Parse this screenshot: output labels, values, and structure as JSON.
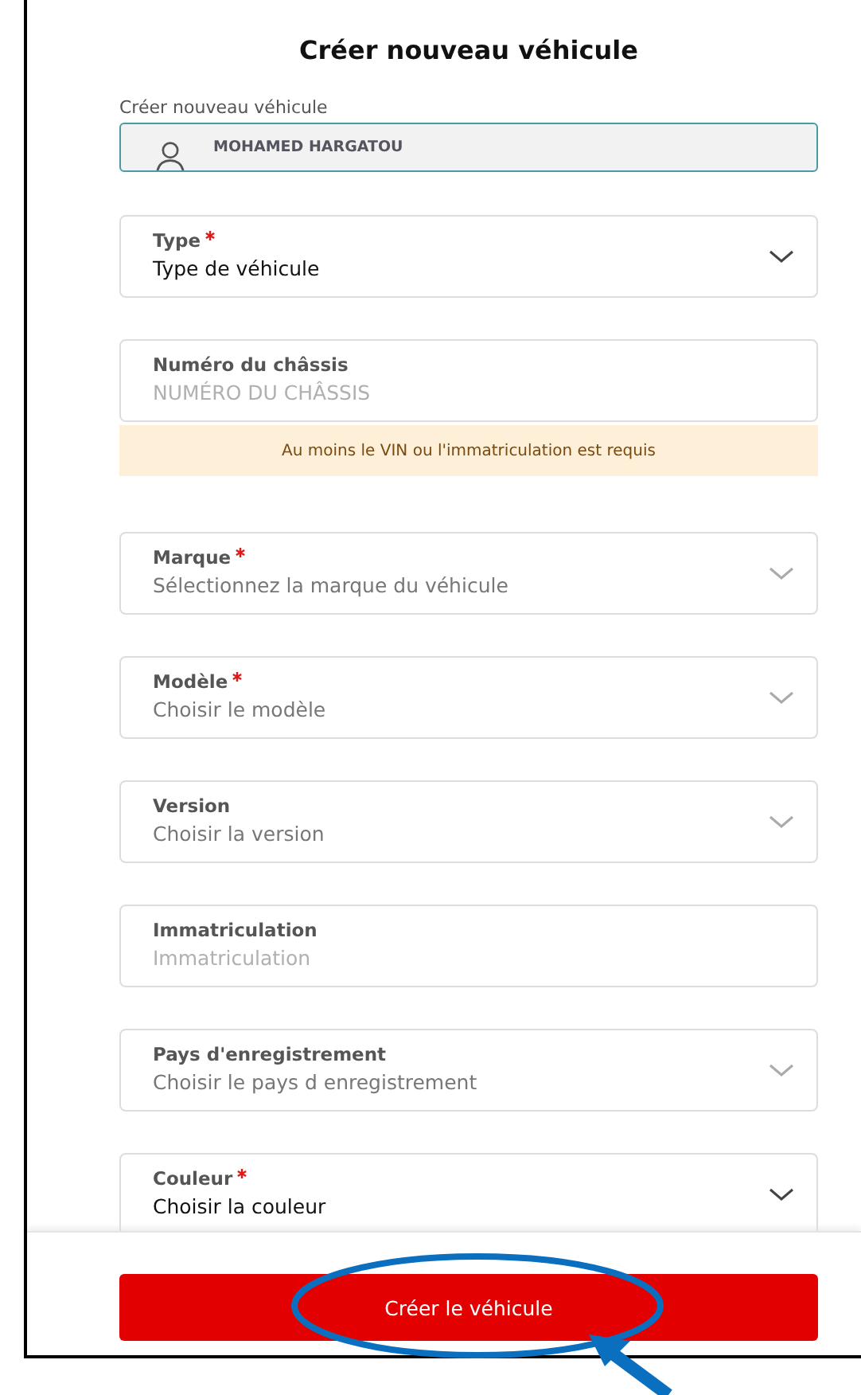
{
  "title": "Créer nouveau véhicule",
  "owner": {
    "label": "Créer nouveau véhicule",
    "value": "MOHAMED HARGATOU"
  },
  "fields": [
    {
      "kind": "select",
      "label": "Type",
      "required": true,
      "value": "Type de véhicule"
    },
    {
      "kind": "text",
      "label": "Numéro du châssis",
      "required": false,
      "placeholder": "NUMÉRO DU CHÂSSIS",
      "warning": "Au moins le VIN ou  l'immatriculation est requis"
    },
    {
      "kind": "select",
      "label": "Marque",
      "required": true,
      "placeholder": "Sélectionnez la marque du véhicule"
    },
    {
      "kind": "select",
      "label": "Modèle",
      "required": true,
      "placeholder": "Choisir le modèle"
    },
    {
      "kind": "select",
      "label": "Version",
      "required": false,
      "placeholder": "Choisir la version"
    },
    {
      "kind": "text",
      "label": "Immatriculation",
      "required": false,
      "placeholder": "Immatriculation"
    },
    {
      "kind": "select",
      "label": "Pays d'enregistrement",
      "required": false,
      "placeholder": "Choisir le pays d enregistrement"
    },
    {
      "kind": "select",
      "label": "Couleur",
      "required": true,
      "value": "Choisir la couleur"
    }
  ],
  "submit": {
    "label": "Créer le véhicule",
    "highlighted": true
  }
}
